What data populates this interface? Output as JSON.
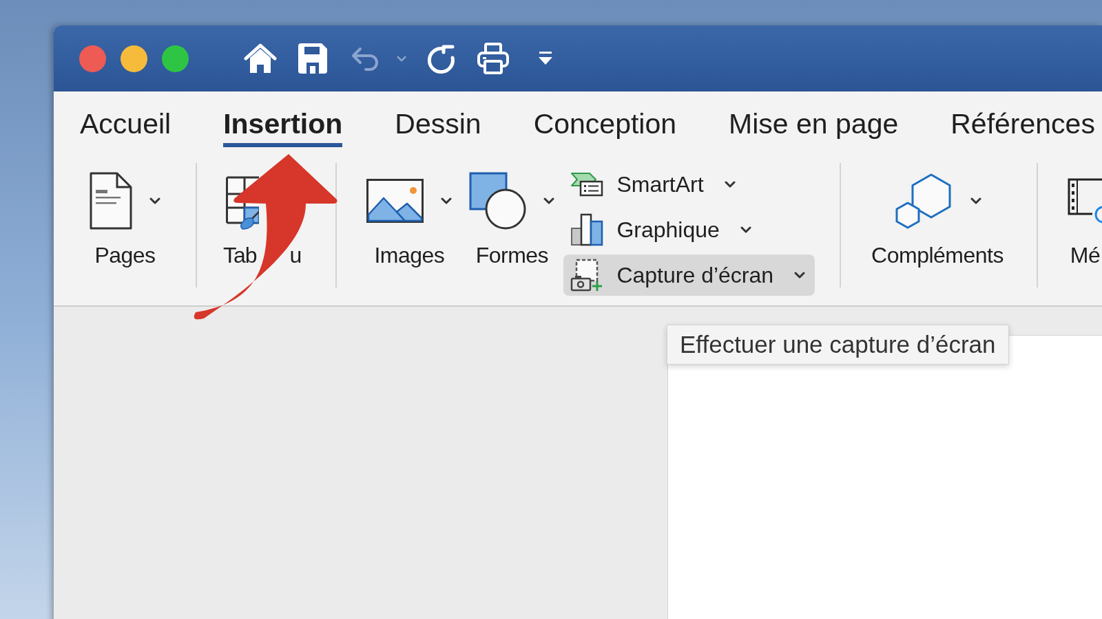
{
  "window": {
    "traffic_lights": [
      {
        "color": "#ee5b54"
      },
      {
        "color": "#f6bb3a"
      },
      {
        "color": "#2fc544"
      }
    ]
  },
  "quick_access": [
    {
      "kind": "home",
      "disabled": false
    },
    {
      "kind": "save",
      "disabled": false
    },
    {
      "kind": "undo",
      "disabled": true,
      "has_menu": true
    },
    {
      "kind": "redo",
      "disabled": false
    },
    {
      "kind": "print",
      "disabled": false
    },
    {
      "kind": "customize",
      "disabled": false
    }
  ],
  "tabs": [
    {
      "label": "Accueil",
      "selected": false
    },
    {
      "label": "Insertion",
      "selected": true
    },
    {
      "label": "Dessin",
      "selected": false
    },
    {
      "label": "Conception",
      "selected": false
    },
    {
      "label": "Mise en page",
      "selected": false
    },
    {
      "label": "Références",
      "selected": false
    }
  ],
  "ribbon": {
    "groups": [
      {
        "large_buttons": [
          {
            "kind": "pages",
            "label": "Pages",
            "has_menu": true
          }
        ]
      },
      {
        "large_buttons": [
          {
            "kind": "table",
            "label_parts": [
              "Tab",
              "u"
            ]
          }
        ]
      },
      {
        "large_buttons": [
          {
            "kind": "images",
            "label": "Images",
            "has_menu": true
          },
          {
            "kind": "shapes",
            "label": "Formes",
            "has_menu": true
          }
        ],
        "small_buttons": [
          {
            "kind": "smartart",
            "label": "SmartArt",
            "has_menu": true,
            "highlighted": false
          },
          {
            "kind": "chart",
            "label": "Graphique",
            "has_menu": true,
            "highlighted": false
          },
          {
            "kind": "screenshot",
            "label": "Capture d’écran",
            "has_menu": true,
            "highlighted": true
          }
        ]
      },
      {
        "large_buttons": [
          {
            "kind": "addins",
            "label": "Compléments",
            "has_menu": true
          }
        ]
      },
      {
        "large_buttons": [
          {
            "kind": "media",
            "label": "Mé"
          }
        ]
      }
    ]
  },
  "tooltip": {
    "text": "Effectuer une capture d’écran"
  }
}
